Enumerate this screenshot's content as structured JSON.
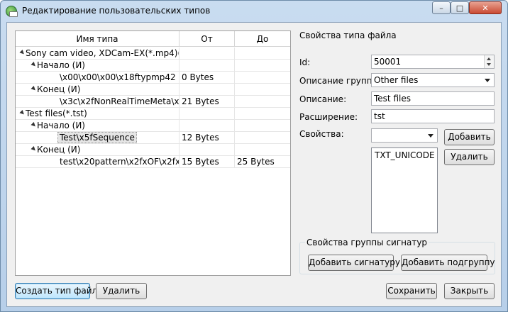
{
  "window": {
    "title": "Редактирование пользовательских типов",
    "minimize_glyph": "–",
    "maximize_glyph": "□",
    "close_glyph": "✕"
  },
  "tree": {
    "columns": [
      "Имя типа",
      "От",
      "До"
    ],
    "rows": [
      {
        "name": "Sony cam video, XDCam-EX(*.mp4)(...",
        "from": "",
        "to": "",
        "level": 0,
        "expanded": true
      },
      {
        "name": "Начало (И)",
        "from": "",
        "to": "",
        "level": 1,
        "expanded": true
      },
      {
        "name": "\\x00\\x00\\x00\\x18ftypmp42",
        "from": "0 Bytes",
        "to": "",
        "level": 2
      },
      {
        "name": "Конец (И)",
        "from": "",
        "to": "",
        "level": 1,
        "expanded": true
      },
      {
        "name": "\\x3c\\x2fNonRealTimeMeta\\x...",
        "from": "21 Bytes",
        "to": "",
        "level": 2
      },
      {
        "name": "Test files(*.tst)",
        "from": "",
        "to": "",
        "level": 0,
        "expanded": true
      },
      {
        "name": "Начало (И)",
        "from": "",
        "to": "",
        "level": 1,
        "expanded": true
      },
      {
        "name": "Test\\x5fSequence",
        "from": "12 Bytes",
        "to": "",
        "level": 2,
        "selected": true
      },
      {
        "name": "Конец (И)",
        "from": "",
        "to": "",
        "level": 1,
        "expanded": true
      },
      {
        "name": "test\\x20pattern\\x2fxOF\\x2fxF...",
        "from": "15 Bytes",
        "to": "25 Bytes",
        "level": 2
      }
    ]
  },
  "props": {
    "section_title": "Свойства типа файла",
    "id_label": "Id:",
    "id_value": "50001",
    "group_label": "Описание группы:",
    "group_value": "Other files",
    "desc_label": "Описание:",
    "desc_value": "Test files",
    "ext_label": "Расширение:",
    "ext_value": "tst",
    "props_label": "Свойства:",
    "props_combo_value": "",
    "add_button": "Добавить",
    "remove_button": "Удалить",
    "props_list": [
      "TXT_UNICODE"
    ]
  },
  "signature_group": {
    "title": "Свойства группы сигнатур",
    "add_signature": "Добавить сигнатуру",
    "add_subgroup": "Добавить подгруппу"
  },
  "footer": {
    "create_type": "Создать тип файла",
    "delete": "Удалить",
    "save": "Сохранить",
    "close": "Закрыть"
  }
}
